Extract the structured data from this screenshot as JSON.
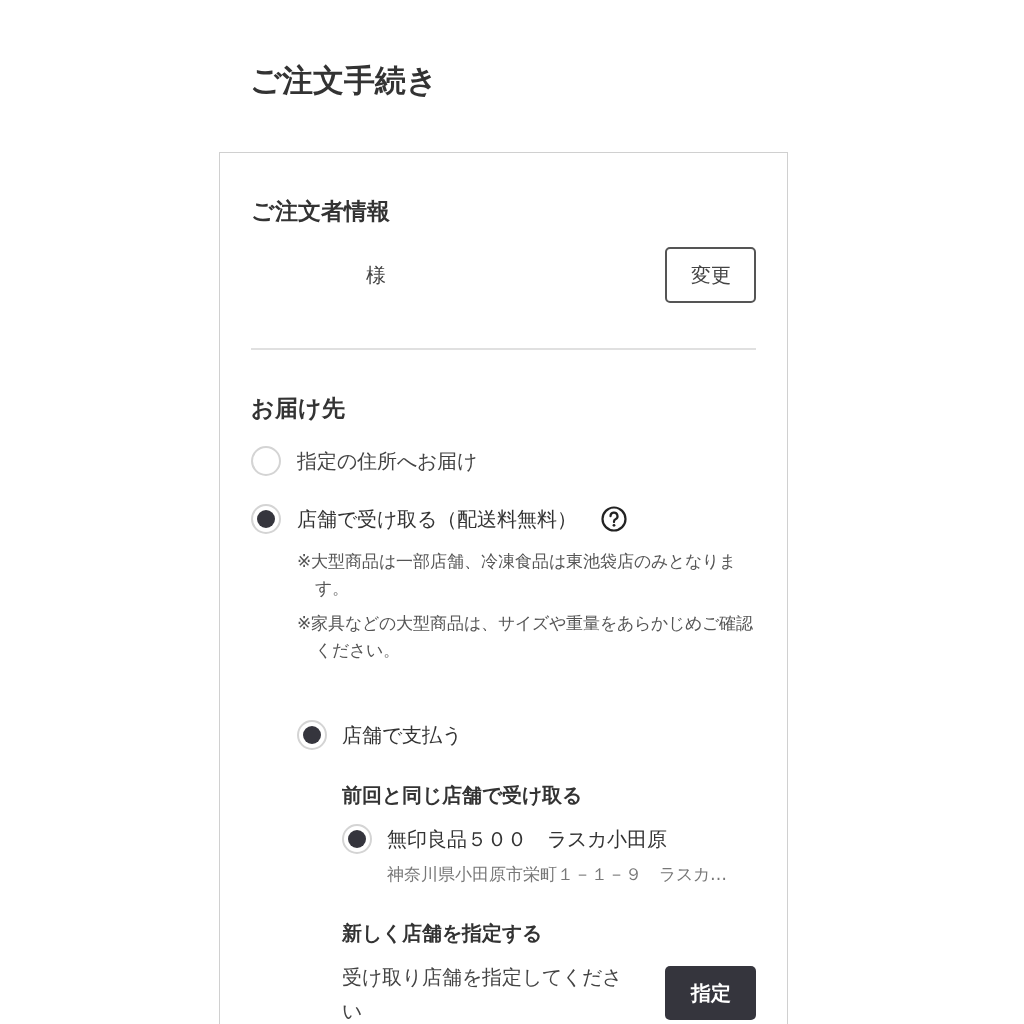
{
  "page_title": "ご注文手続き",
  "orderer": {
    "heading": "ご注文者情報",
    "honorific": "様",
    "change_button": "変更"
  },
  "delivery": {
    "heading": "お届け先",
    "options": [
      {
        "label": "指定の住所へお届け",
        "selected": false
      },
      {
        "label": "店舗で受け取る（配送料無料）",
        "selected": true,
        "help": true,
        "notes": [
          "※大型商品は一部店舗、冷凍食品は東池袋店のみとなります。",
          "※家具などの大型商品は、サイズや重量をあらかじめご確認ください。"
        ],
        "payment_options": [
          {
            "label": "店舗で支払う",
            "selected": true
          }
        ],
        "previous_store": {
          "heading": "前回と同じ店舗で受け取る",
          "stores": [
            {
              "name": "無印良品５００　ラスカ小田原",
              "address": "神奈川県小田原市栄町１－１－９　ラスカ…",
              "selected": true
            }
          ]
        },
        "new_store": {
          "heading": "新しく店舗を指定する",
          "prompt": "受け取り店舗を指定してください",
          "button": "指定"
        }
      }
    ]
  }
}
